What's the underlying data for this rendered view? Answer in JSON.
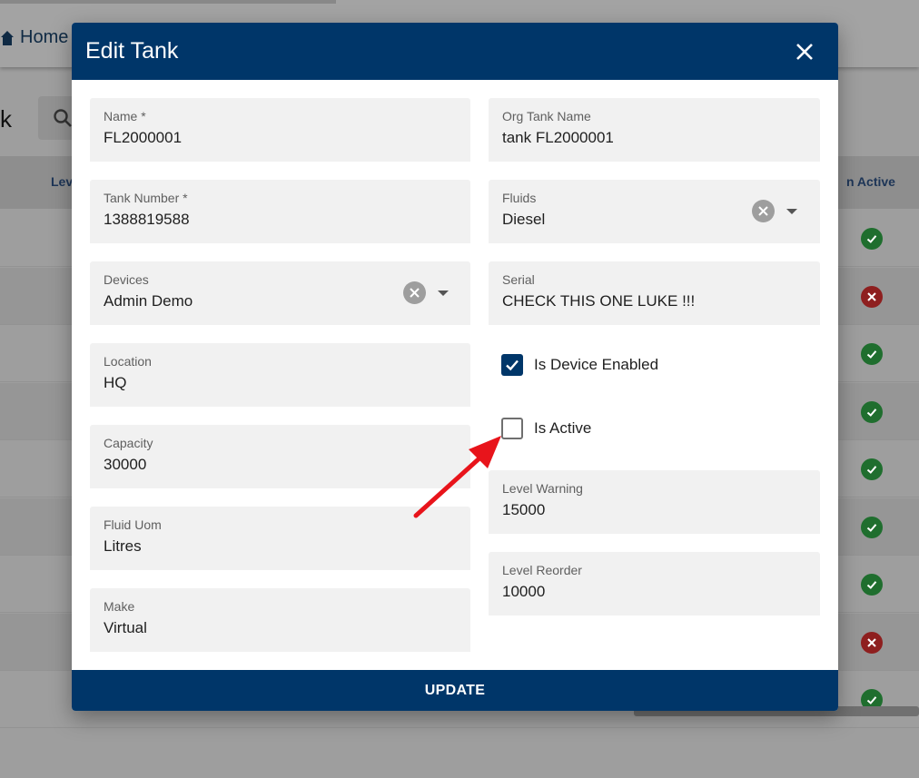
{
  "background": {
    "home_label": "Home",
    "page_title_fragment": "k",
    "columns": {
      "level": "Lev",
      "active": "n Active"
    },
    "row_statuses": [
      "ok",
      "bad",
      "ok",
      "ok",
      "ok",
      "ok",
      "ok",
      "bad",
      "ok"
    ]
  },
  "dialog": {
    "title": "Edit Tank",
    "update_label": "UPDATE",
    "fields": {
      "name": {
        "label": "Name *",
        "value": "FL2000001"
      },
      "org_tank_name": {
        "label": "Org Tank Name",
        "value": "tank FL2000001"
      },
      "tank_number": {
        "label": "Tank Number *",
        "value": "1388819588"
      },
      "fluids": {
        "label": "Fluids",
        "value": "Diesel"
      },
      "devices": {
        "label": "Devices",
        "value": "Admin Demo"
      },
      "serial": {
        "label": "Serial",
        "value": "CHECK THIS ONE LUKE !!!"
      },
      "location": {
        "label": "Location",
        "value": "HQ"
      },
      "capacity": {
        "label": "Capacity",
        "value": "30000"
      },
      "fluid_uom": {
        "label": "Fluid Uom",
        "value": "Litres"
      },
      "make": {
        "label": "Make",
        "value": "Virtual"
      },
      "level_warning": {
        "label": "Level Warning",
        "value": "15000"
      },
      "level_reorder": {
        "label": "Level Reorder",
        "value": "10000"
      }
    },
    "checkboxes": {
      "is_device_enabled": {
        "label": "Is Device Enabled",
        "checked": true
      },
      "is_active": {
        "label": "Is Active",
        "checked": false
      }
    }
  },
  "colors": {
    "primary": "#003669",
    "annotation_arrow": "#e8141b",
    "status_ok": "#1f6e2e",
    "status_bad": "#8e1f1f"
  },
  "icons": {
    "home": "home-icon",
    "search": "search-icon",
    "close": "close-icon",
    "clear": "clear-circle-icon",
    "dropdown": "chevron-down-icon",
    "check": "check-icon",
    "status_ok": "check-circle-icon",
    "status_bad": "x-circle-icon"
  }
}
